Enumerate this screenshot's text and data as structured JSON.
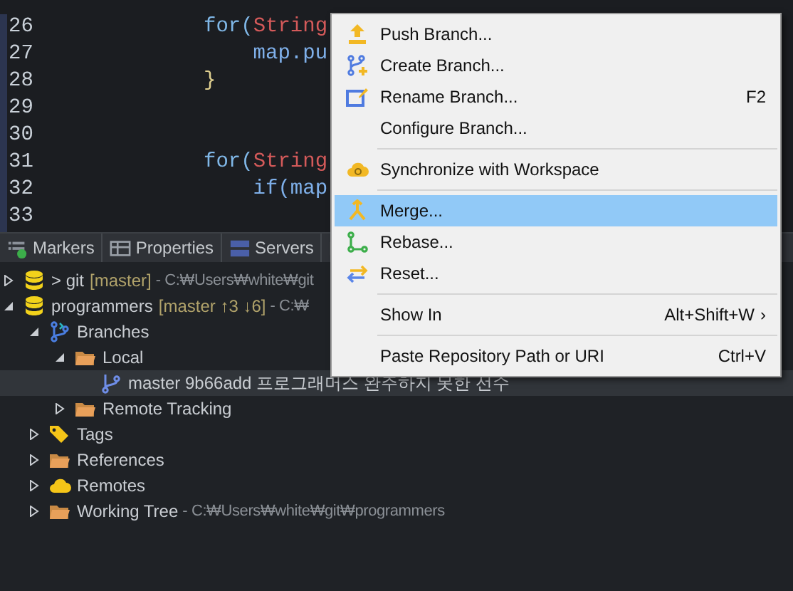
{
  "editor": {
    "lines": [
      {
        "number": "26",
        "tokens": [
          {
            "kind": "keyword",
            "text": "for("
          },
          {
            "kind": "type",
            "text": "String"
          }
        ]
      },
      {
        "number": "27",
        "tokens": [
          {
            "kind": "plain",
            "text": "    map.pu"
          }
        ]
      },
      {
        "number": "28",
        "tokens": [
          {
            "kind": "brace",
            "text": "}"
          }
        ]
      },
      {
        "number": "29"
      },
      {
        "number": "30"
      },
      {
        "number": "31",
        "tokens": [
          {
            "kind": "keyword",
            "text": "for("
          },
          {
            "kind": "type",
            "text": "String"
          }
        ]
      },
      {
        "number": "32",
        "tokens": [
          {
            "kind": "plain",
            "text": "    if(map"
          }
        ]
      },
      {
        "number": "33"
      }
    ]
  },
  "view_tabs": [
    {
      "label": "Markers"
    },
    {
      "label": "Properties"
    },
    {
      "label": "Servers"
    }
  ],
  "tree": [
    {
      "kind": "repository",
      "label": "> git",
      "decoration": "[master]",
      "path": "- C:₩Users₩white₩git",
      "expanded": false,
      "selected": false
    },
    {
      "kind": "repository",
      "label": "programmers",
      "decoration": "[master ↑3 ↓6]",
      "path": "- C:₩",
      "expanded": true,
      "selected": false,
      "children": [
        {
          "kind": "branches",
          "label": "Branches",
          "expanded": true,
          "selected": false,
          "children": [
            {
              "kind": "folder",
              "label": "Local",
              "expanded": true,
              "selected": false,
              "children": [
                {
                  "kind": "branch",
                  "label": "master 9b66add 프로그래머스 완주하지 못한 선수",
                  "selected": true
                }
              ]
            },
            {
              "kind": "folder",
              "label": "Remote Tracking",
              "expanded": false,
              "selected": false
            }
          ]
        },
        {
          "kind": "tag",
          "label": "Tags",
          "expanded": false,
          "selected": false
        },
        {
          "kind": "folder",
          "label": "References",
          "expanded": false,
          "selected": false
        },
        {
          "kind": "cloud",
          "label": "Remotes",
          "expanded": false,
          "selected": false
        },
        {
          "kind": "folder",
          "label": "Working Tree",
          "path": "- C:₩Users₩white₩git₩programmers",
          "expanded": false,
          "selected": false
        }
      ]
    }
  ],
  "context_menu": [
    {
      "kind": "item",
      "label": "Push Branch...",
      "selected": false
    },
    {
      "kind": "item",
      "label": "Create Branch...",
      "selected": false
    },
    {
      "kind": "item",
      "label": "Rename Branch...",
      "shortcut": "F2",
      "selected": false
    },
    {
      "kind": "item",
      "label": "Configure Branch...",
      "selected": false
    },
    {
      "kind": "separator"
    },
    {
      "kind": "item",
      "label": "Synchronize with Workspace",
      "selected": false
    },
    {
      "kind": "separator"
    },
    {
      "kind": "item",
      "label": "Merge...",
      "selected": true
    },
    {
      "kind": "item",
      "label": "Rebase...",
      "selected": false
    },
    {
      "kind": "item",
      "label": "Reset...",
      "selected": false
    },
    {
      "kind": "separator"
    },
    {
      "kind": "item",
      "label": "Show In",
      "shortcut": "Alt+Shift+W",
      "submenu": "›",
      "selected": false
    },
    {
      "kind": "separator"
    },
    {
      "kind": "item",
      "label": "Paste Repository Path or URI",
      "shortcut": "Ctrl+V",
      "selected": false
    }
  ]
}
